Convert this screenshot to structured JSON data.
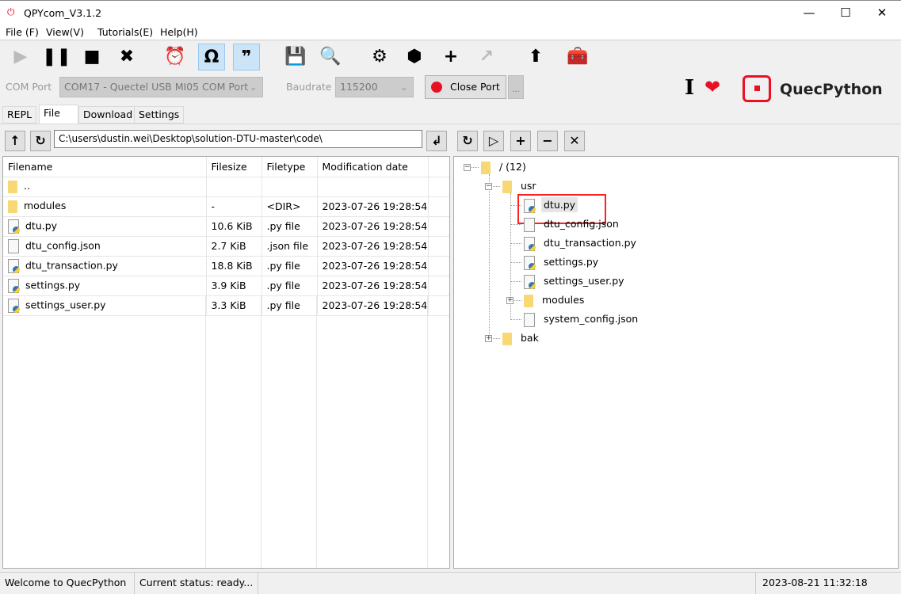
{
  "window": {
    "title": "QPYcom_V3.1.2",
    "minimize": "—",
    "maximize": "☐",
    "close": "✕"
  },
  "menu": [
    "File (F)",
    "View(V)",
    "Tutorials(E)",
    "Help(H)"
  ],
  "toolbar": {
    "icons": [
      "play-icon",
      "pause-icon",
      "stop-icon",
      "close-icon",
      "alarm-icon",
      "hotkey-icon",
      "quote-icon",
      "save-icon",
      "search-icon",
      "gear-icon",
      "package-icon",
      "add-icon",
      "export-icon",
      "upload-icon",
      "toolbox-icon"
    ],
    "glyphs": [
      "▶",
      "❚❚",
      "■",
      "✖",
      "⏰",
      "Ω",
      "❞",
      "💾",
      "🔍",
      "⚙",
      "⬢",
      "+",
      "↗",
      "⬆",
      "🧰"
    ],
    "active": [
      5,
      6
    ]
  },
  "port": {
    "com_label": "COM Port",
    "com_value": "COM17 - Quectel USB MI05 COM Port",
    "baud_label": "Baudrate",
    "baud_value": "115200",
    "close_port": "Close Port",
    "more": "...",
    "status_color": "#e81123"
  },
  "brand": {
    "name": "QuecPython",
    "accent": "#e81123"
  },
  "tabs": [
    "REPL",
    "File",
    "Download",
    "Settings"
  ],
  "local": {
    "path": "C:\\users\\dustin.wei\\Desktop\\solution-DTU-master\\code\\",
    "columns": [
      "Filename",
      "Filesize",
      "Filetype",
      "Modification date"
    ],
    "rows": [
      {
        "name": "..",
        "size": "",
        "type": "",
        "date": "",
        "icon": "folder"
      },
      {
        "name": "modules",
        "size": "-",
        "type": "<DIR>",
        "date": "2023-07-26 19:28:54",
        "icon": "folder"
      },
      {
        "name": "dtu.py",
        "size": "10.6 KiB",
        "type": ".py file",
        "date": "2023-07-26 19:28:54",
        "icon": "py"
      },
      {
        "name": "dtu_config.json",
        "size": "2.7 KiB",
        "type": ".json file",
        "date": "2023-07-26 19:28:54",
        "icon": "file"
      },
      {
        "name": "dtu_transaction.py",
        "size": "18.8 KiB",
        "type": ".py file",
        "date": "2023-07-26 19:28:54",
        "icon": "py"
      },
      {
        "name": "settings.py",
        "size": "3.9 KiB",
        "type": ".py file",
        "date": "2023-07-26 19:28:54",
        "icon": "py"
      },
      {
        "name": "settings_user.py",
        "size": "3.3 KiB",
        "type": ".py file",
        "date": "2023-07-26 19:28:54",
        "icon": "py"
      }
    ]
  },
  "device": {
    "tree": [
      {
        "label": "/ (12)",
        "level": 0,
        "icon": "folder",
        "expander": "−"
      },
      {
        "label": "usr",
        "level": 1,
        "icon": "folder",
        "expander": "−"
      },
      {
        "label": "dtu.py",
        "level": 2,
        "icon": "py",
        "selected": true
      },
      {
        "label": "dtu_config.json",
        "level": 2,
        "icon": "file"
      },
      {
        "label": "dtu_transaction.py",
        "level": 2,
        "icon": "py"
      },
      {
        "label": "settings.py",
        "level": 2,
        "icon": "py"
      },
      {
        "label": "settings_user.py",
        "level": 2,
        "icon": "py"
      },
      {
        "label": "modules",
        "level": 2,
        "icon": "folder",
        "expander": "+"
      },
      {
        "label": "system_config.json",
        "level": 2,
        "icon": "file"
      },
      {
        "label": "bak",
        "level": 1,
        "icon": "folder",
        "expander": "+"
      }
    ]
  },
  "status": {
    "welcome": "Welcome to QuecPython",
    "current": "Current status: ready...",
    "datetime": "2023-08-21 11:32:18"
  }
}
